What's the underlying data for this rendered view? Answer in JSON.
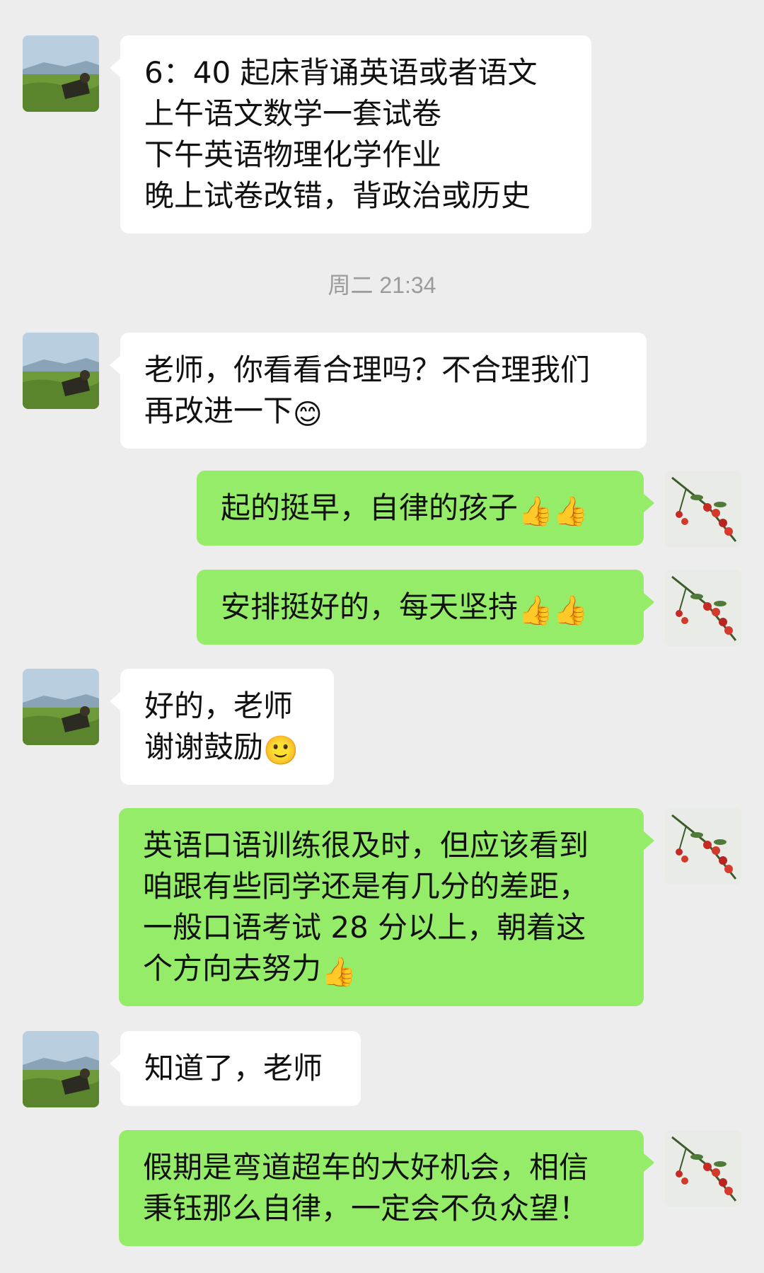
{
  "timestamp": "周二 21:34",
  "colors": {
    "background": "#ededed",
    "bubble_left": "#ffffff",
    "bubble_right": "#95ec69",
    "timestamp_text": "#9b9b9b"
  },
  "messages": [
    {
      "side": "left",
      "lines": [
        "6：40 起床背诵英语或者语文",
        "上午语文数学一套试卷",
        "下午英语物理化学作业",
        "晚上试卷改错，背政治或历史"
      ]
    },
    {
      "side": "left",
      "lines": [
        "老师，你看看合理吗？不合理我们",
        "再改进一下"
      ],
      "emoji": "smile-emoji"
    },
    {
      "side": "right",
      "lines": [
        "起的挺早，自律的孩子"
      ],
      "emoji": "thumbs-up-emoji x2"
    },
    {
      "side": "right",
      "lines": [
        "安排挺好的，每天坚持"
      ],
      "emoji": "thumbs-up-emoji x2"
    },
    {
      "side": "left",
      "lines": [
        "好的，老师",
        "谢谢鼓励"
      ],
      "emoji": "shy-emoji"
    },
    {
      "side": "right",
      "lines": [
        "英语口语训练很及时，但应该看到",
        "咱跟有些同学还是有几分的差距，",
        "一般口语考试 28 分以上，朝着这",
        "个方向去努力"
      ],
      "emoji": "thumbs-up-emoji"
    },
    {
      "side": "left",
      "lines": [
        "知道了，老师"
      ]
    },
    {
      "side": "right",
      "lines": [
        "假期是弯道超车的大好机会，相信",
        "秉钰那么自律，一定会不负众望！"
      ]
    }
  ]
}
